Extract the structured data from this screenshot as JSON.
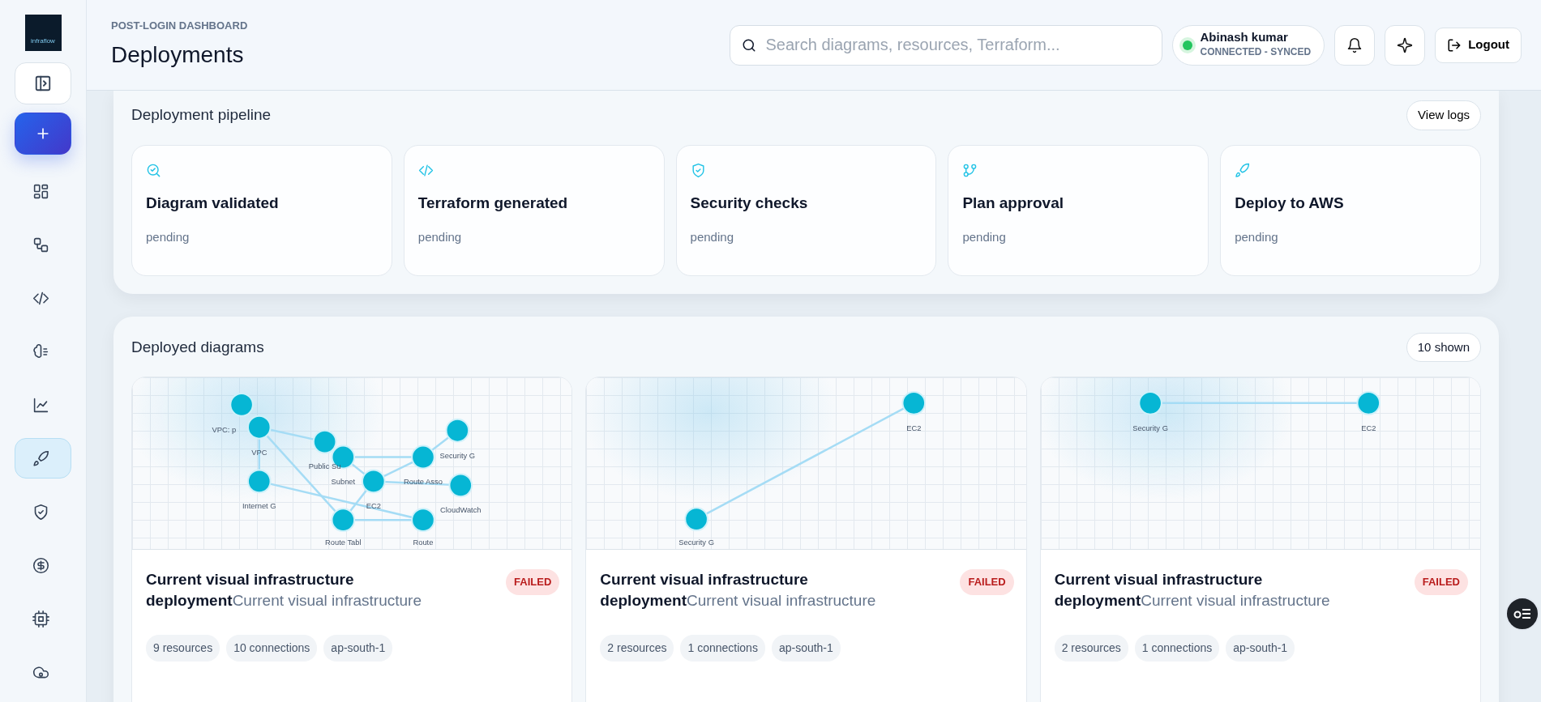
{
  "logo": {
    "text": "infraflow"
  },
  "sidebar": {
    "toggle": {
      "selected": false
    },
    "new": {
      "selected": false
    },
    "items": [
      {
        "selected": false
      },
      {
        "selected": false
      },
      {
        "selected": false
      },
      {
        "selected": false
      },
      {
        "selected": false
      },
      {
        "selected": true
      },
      {
        "selected": false
      },
      {
        "selected": false
      },
      {
        "selected": false
      },
      {
        "selected": false
      }
    ]
  },
  "header": {
    "eyebrow": "POST-LOGIN DASHBOARD",
    "title": "Deployments",
    "search": {
      "placeholder": "Search diagrams, resources, Terraform..."
    },
    "user": {
      "name": "Abinash kumar",
      "status": "CONNECTED - SYNCED",
      "online": true
    },
    "logout": "Logout"
  },
  "pipeline": {
    "title": "Deployment pipeline",
    "action": "View logs",
    "steps": [
      {
        "title": "Diagram validated",
        "status": "pending"
      },
      {
        "title": "Terraform generated",
        "status": "pending"
      },
      {
        "title": "Security checks",
        "status": "pending"
      },
      {
        "title": "Plan approval",
        "status": "pending"
      },
      {
        "title": "Deploy to AWS",
        "status": "pending"
      }
    ]
  },
  "diagrams": {
    "title": "Deployed diagrams",
    "count": "10 shown",
    "cards": [
      {
        "nodes": [
          "VPC: p",
          "VPC",
          "Internet G",
          "Public Su",
          "Subnet",
          "EC2",
          "Route Asso",
          "Security G",
          "CloudWatch",
          "Route Tabl",
          "Route"
        ],
        "title": "Current visual infrastructure deployment",
        "subtitle": "Current visual infrastructure",
        "status": {
          "kind": "failed",
          "label": "FAILED"
        },
        "tags": [
          "9 resources",
          "10 connections",
          "ap-south-1"
        ]
      },
      {
        "nodes": [
          "EC2",
          "Security G"
        ],
        "title": "Current visual infrastructure deployment",
        "subtitle": "Current visual infrastructure",
        "status": {
          "kind": "failed",
          "label": "FAILED"
        },
        "tags": [
          "2 resources",
          "1 connections",
          "ap-south-1"
        ]
      },
      {
        "nodes": [
          "Security G",
          "EC2"
        ],
        "title": "Current visual infrastructure deployment",
        "subtitle": "Current visual infrastructure",
        "status": {
          "kind": "failed",
          "label": "FAILED"
        },
        "tags": [
          "2 resources",
          "1 connections",
          "ap-south-1"
        ]
      }
    ]
  }
}
